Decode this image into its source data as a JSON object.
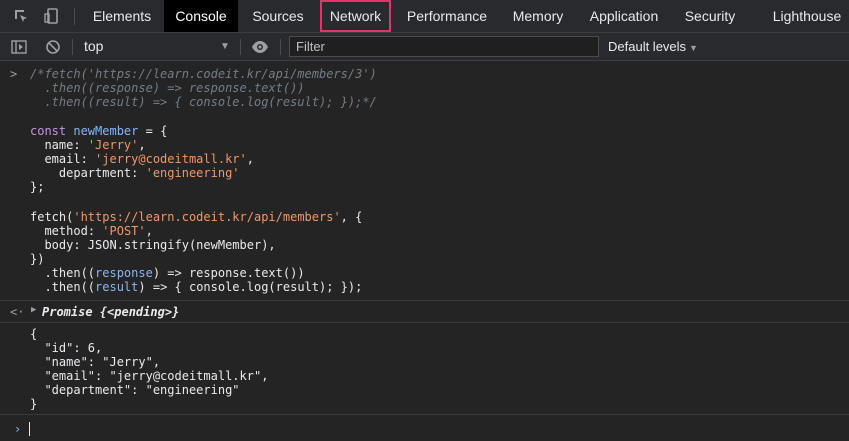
{
  "tabs": [
    {
      "label": "Elements"
    },
    {
      "label": "Console"
    },
    {
      "label": "Sources"
    },
    {
      "label": "Network"
    },
    {
      "label": "Performance"
    },
    {
      "label": "Memory"
    },
    {
      "label": "Application"
    },
    {
      "label": "Security"
    },
    {
      "label": "Lighthouse"
    }
  ],
  "toolbar": {
    "context": "top",
    "filter_placeholder": "Filter",
    "levels": "Default levels"
  },
  "input_block": {
    "comment": [
      "/*fetch('https://learn.codeit.kr/api/members/3')",
      "  .then((response) => response.text())",
      "  .then((result) => { console.log(result); });*/"
    ],
    "decl_const": "const",
    "decl_name": "newMember",
    "name_key": "name",
    "name_val": "'Jerry'",
    "email_key": "email",
    "email_val": "'jerry@codeitmall.kr'",
    "dept_key": "department",
    "dept_val": "'engineering'",
    "fetch_url": "'https://learn.codeit.kr/api/members'",
    "method_key": "method",
    "method_val": "'POST'",
    "body_key": "body",
    "then1_arg": "response",
    "then2_arg": "result"
  },
  "promise_text": "Promise {<pending>}",
  "output_lines": [
    "{",
    "  \"id\": 6,",
    "  \"name\": \"Jerry\",",
    "  \"email\": \"jerry@codeitmall.kr\",",
    "  \"department\": \"engineering\"",
    "}"
  ],
  "colors": {
    "accent": "#e2336b",
    "keyword": "#c792ea",
    "identifier": "#8ab4f8",
    "string": "#f29766"
  }
}
